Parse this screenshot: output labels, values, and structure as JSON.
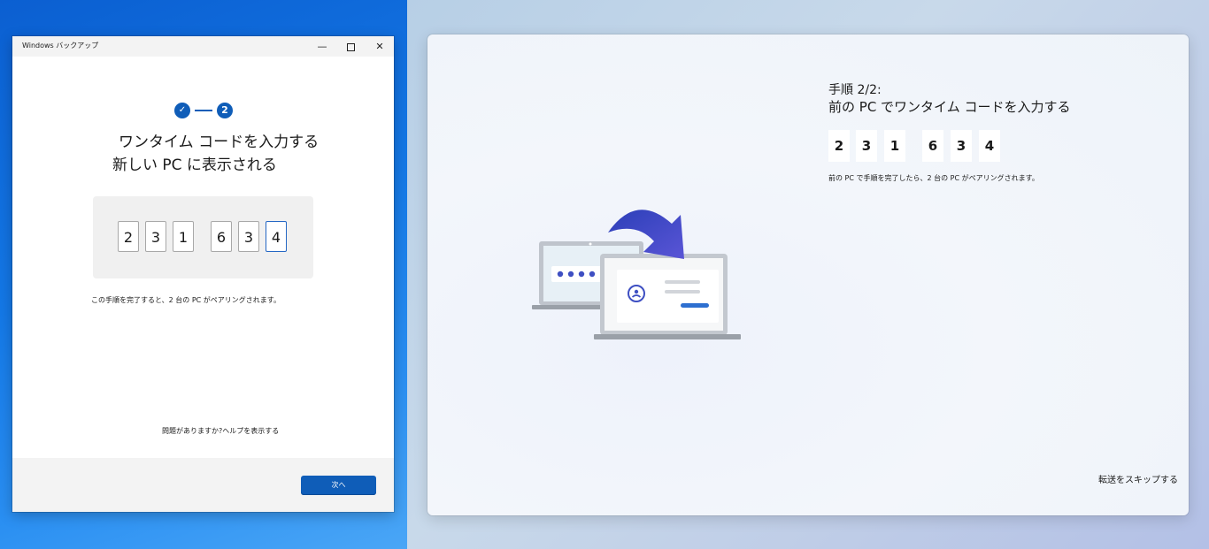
{
  "left_window": {
    "title": "Windows バックアップ",
    "controls": {
      "minimize": "—",
      "close": "✕"
    },
    "stepper": {
      "done_icon": "✓",
      "current_step": "2"
    },
    "heading_line1": "ワンタイム コードを入力する",
    "heading_line2": "新しい PC に表示される",
    "code_digits": [
      "2",
      "3",
      "1",
      "6",
      "3",
      "4"
    ],
    "note": "この手順を完了すると、2 台の PC がペアリングされます。",
    "help_link": "問題がありますか?ヘルプを表示する",
    "next_button": "次へ"
  },
  "right_panel": {
    "step_label": "手順 2/2:",
    "heading": "前の PC でワンタイム コードを入力する",
    "code_digits": [
      "2",
      "3",
      "1",
      "6",
      "3",
      "4"
    ],
    "note": "前の PC で手順を完了したら、2 台の PC がペアリングされます。",
    "skip_link": "転送をスキップする"
  },
  "colors": {
    "accent": "#0f5db8",
    "arrow_start": "#2b3fb8",
    "arrow_end": "#5a55d6"
  }
}
